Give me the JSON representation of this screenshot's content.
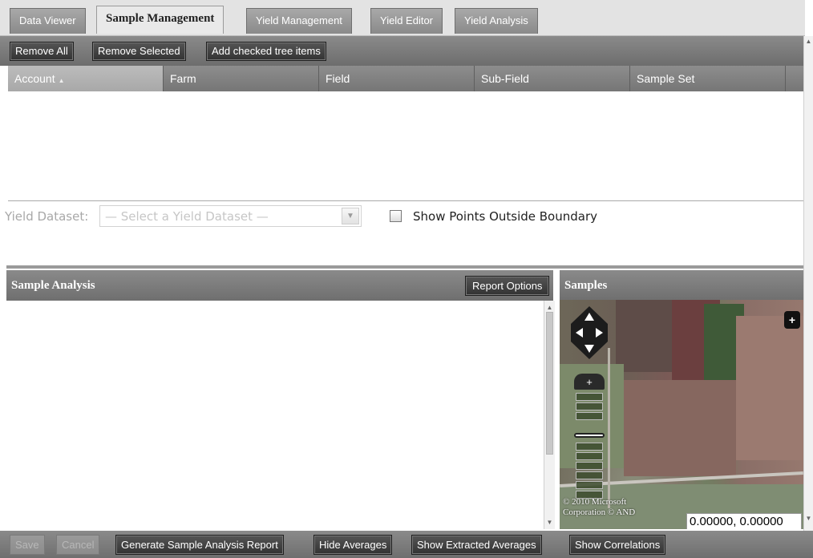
{
  "tabs": [
    {
      "label": "Data Viewer"
    },
    {
      "label": "Sample Management",
      "active": true
    },
    {
      "label": "Yield Management"
    },
    {
      "label": "Yield Editor"
    },
    {
      "label": "Yield Analysis"
    }
  ],
  "toolbar": {
    "remove_all": "Remove All",
    "remove_selected": "Remove Selected",
    "add_checked": "Add checked tree items"
  },
  "grid": {
    "columns": [
      "Account",
      "Farm",
      "Field",
      "Sub-Field",
      "Sample Set"
    ],
    "sorted_column": "Account"
  },
  "yield": {
    "label": "Yield Dataset:",
    "placeholder": "— Select a Yield Dataset —",
    "checkbox_label": "Show Points Outside Boundary",
    "checkbox_checked": false
  },
  "sample_analysis": {
    "title": "Sample Analysis",
    "report_options": "Report Options"
  },
  "samples": {
    "title": "Samples",
    "copyright_line1": "© 2010 Microsoft",
    "copyright_line2": "Corporation © AND",
    "coords": "0.00000, 0.00000"
  },
  "bottom": {
    "save": "Save",
    "cancel": "Cancel",
    "generate": "Generate Sample Analysis Report",
    "hide_averages": "Hide Averages",
    "show_extracted": "Show Extracted Averages",
    "show_correlations": "Show Correlations"
  },
  "colors": {
    "header_gray": "#7a7a7a",
    "button_dark": "#3a3a3a",
    "tab_active": "#e9e9e9"
  },
  "icons": [
    "pan-icon",
    "zoom-in-icon",
    "zoom-out-icon",
    "plus-icon",
    "dropdown-arrow-icon",
    "sort-ascending-icon"
  ]
}
